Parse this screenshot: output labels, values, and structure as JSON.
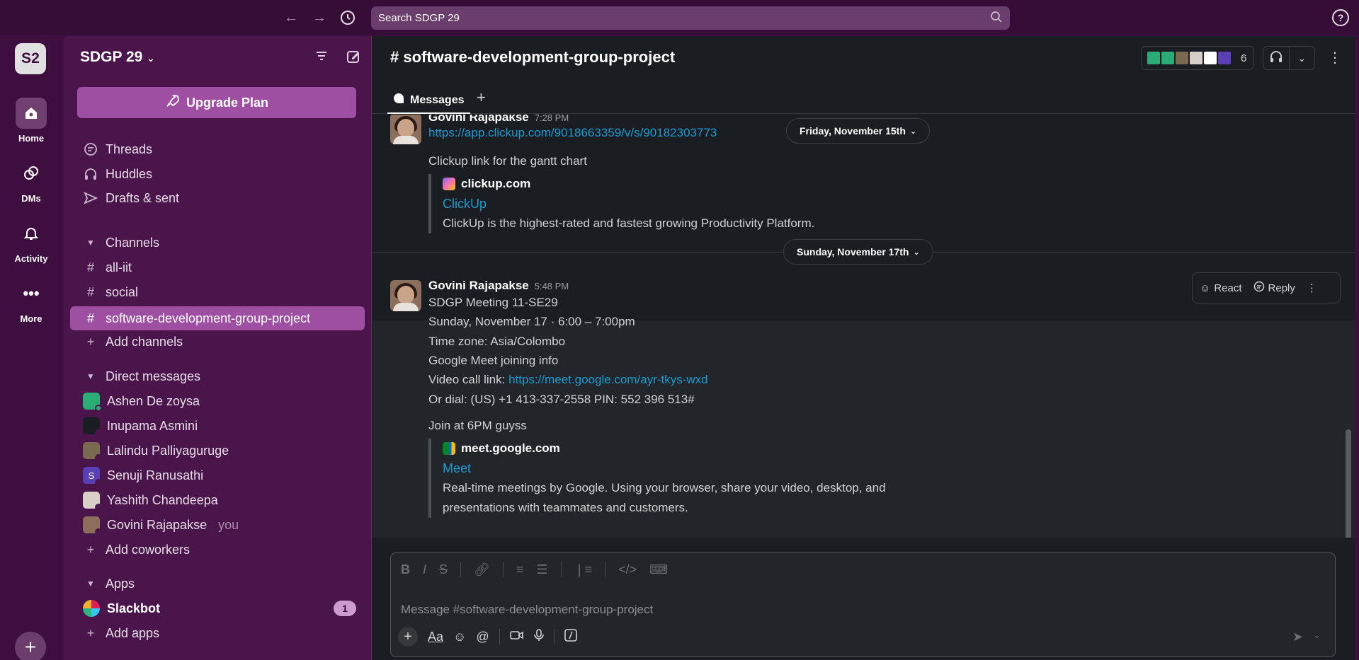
{
  "topbar": {
    "search_placeholder": "Search SDGP 29",
    "help": "?"
  },
  "rail": {
    "workspace_badge": "S2",
    "items": [
      {
        "label": "Home"
      },
      {
        "label": "DMs"
      },
      {
        "label": "Activity"
      },
      {
        "label": "More"
      }
    ],
    "add": "+"
  },
  "sidebar": {
    "workspace_name": "SDGP 29",
    "upgrade_label": "Upgrade Plan",
    "top_items": [
      {
        "label": "Threads",
        "icon": "threads-icon"
      },
      {
        "label": "Huddles",
        "icon": "headphones-icon"
      },
      {
        "label": "Drafts & sent",
        "icon": "send-icon"
      }
    ],
    "channels_header": "Channels",
    "channels": [
      {
        "name": "all-iit"
      },
      {
        "name": "social"
      },
      {
        "name": "software-development-group-project",
        "active": true
      }
    ],
    "add_channels": "Add channels",
    "dms_header": "Direct messages",
    "dms": [
      {
        "name": "Ashen De zoysa",
        "color": "#2bac76",
        "initial": "",
        "online": true
      },
      {
        "name": "Inupama Asmini",
        "color": "#1a1d21",
        "initial": "",
        "online": false
      },
      {
        "name": "Lalindu Palliyaguruge",
        "color": "#7a6a4f",
        "initial": "",
        "online": false
      },
      {
        "name": "Senuji Ranusathi",
        "color": "#5b3fb5",
        "initial": "S",
        "online": false
      },
      {
        "name": "Yashith Chandeepa",
        "color": "#d8d0c8",
        "initial": "",
        "online": false
      },
      {
        "name": "Govini Rajapakse",
        "color": "#8b6f5c",
        "initial": "",
        "online": false,
        "you": "you"
      }
    ],
    "add_coworkers": "Add coworkers",
    "apps_header": "Apps",
    "apps": [
      {
        "name": "Slackbot",
        "badge": "1"
      }
    ],
    "add_apps": "Add apps"
  },
  "channel": {
    "title": "# software-development-group-project",
    "member_count": "6",
    "tab_label": "Messages"
  },
  "messages": {
    "first": {
      "author": "Govini Rajapakse",
      "time": "7:28 PM",
      "link": "https://app.clickup.com/9018663359/v/s/90182303773",
      "text": "Clickup link for the gantt chart",
      "unfurl": {
        "site": "clickup.com",
        "title": "ClickUp",
        "desc": "ClickUp is the highest-rated and fastest growing Productivity Platform."
      }
    },
    "date_1": "Friday, November 15th",
    "date_2": "Sunday, November 17th",
    "second": {
      "author": "Govini Rajapakse",
      "time": "5:48 PM",
      "lines": [
        "SDGP Meeting 11-SE29",
        "Sunday, November 17 · 6:00 – 7:00pm",
        "Time zone: Asia/Colombo",
        "Google Meet joining info"
      ],
      "video_prefix": "Video call link: ",
      "video_link": "https://meet.google.com/ayr-tkys-wxd",
      "dial": "Or dial: (US) +1 413-337-2558 PIN: 552 396 513#",
      "join": "Join at 6PM guyss",
      "unfurl": {
        "site": "meet.google.com",
        "title": "Meet",
        "desc_1": "Real-time meetings by Google. Using your browser, share your video, desktop, and",
        "desc_2": "presentations with teammates and customers."
      }
    },
    "actions": {
      "react": "React",
      "reply": "Reply"
    }
  },
  "composer": {
    "placeholder": "Message #software-development-group-project"
  }
}
